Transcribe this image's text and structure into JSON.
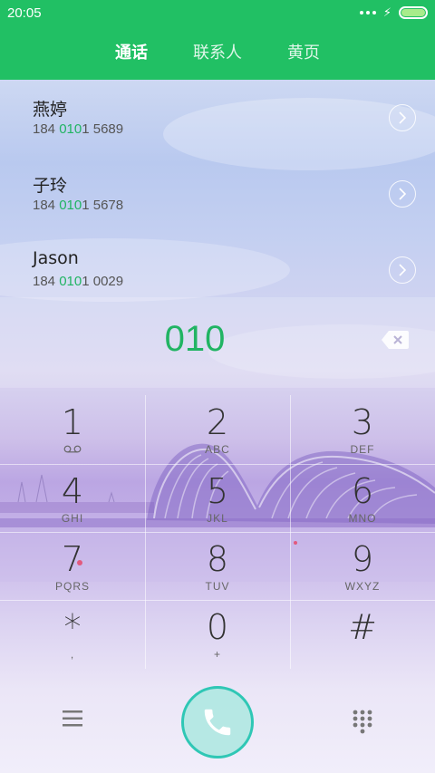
{
  "status_bar": {
    "time": "20:05",
    "battery_level": 1.0
  },
  "tabs": [
    {
      "label": "通话",
      "active": true
    },
    {
      "label": "联系人",
      "active": false
    },
    {
      "label": "黄页",
      "active": false
    }
  ],
  "contacts": [
    {
      "name": "燕婷",
      "number_prefix": "184 ",
      "number_match": "010",
      "number_suffix": "1 5689"
    },
    {
      "name": "子玲",
      "number_prefix": "184 ",
      "number_match": "010",
      "number_suffix": "1 5678"
    },
    {
      "name": "Jason",
      "number_prefix": "184 ",
      "number_match": "010",
      "number_suffix": "1 0029"
    }
  ],
  "dial": {
    "value": "010"
  },
  "keypad": [
    {
      "digit": "1",
      "sub": ""
    },
    {
      "digit": "2",
      "sub": "ABC"
    },
    {
      "digit": "3",
      "sub": "DEF"
    },
    {
      "digit": "4",
      "sub": "GHI"
    },
    {
      "digit": "5",
      "sub": "JKL"
    },
    {
      "digit": "6",
      "sub": "MNO"
    },
    {
      "digit": "7",
      "sub": "PQRS"
    },
    {
      "digit": "8",
      "sub": "TUV"
    },
    {
      "digit": "9",
      "sub": "WXYZ"
    },
    {
      "digit": "*",
      "sub": ","
    },
    {
      "digit": "0",
      "sub": "+"
    },
    {
      "digit": "#",
      "sub": ""
    }
  ],
  "icons": {
    "voicemail": "voicemail-icon",
    "backspace": "backspace-icon",
    "chevron": "chevron-right-icon",
    "menu": "menu-icon",
    "call": "phone-icon",
    "dialpad": "dialpad-icon"
  },
  "colors": {
    "header": "#21c064",
    "accent": "#21b463",
    "call_button": "#2fc7b5"
  }
}
